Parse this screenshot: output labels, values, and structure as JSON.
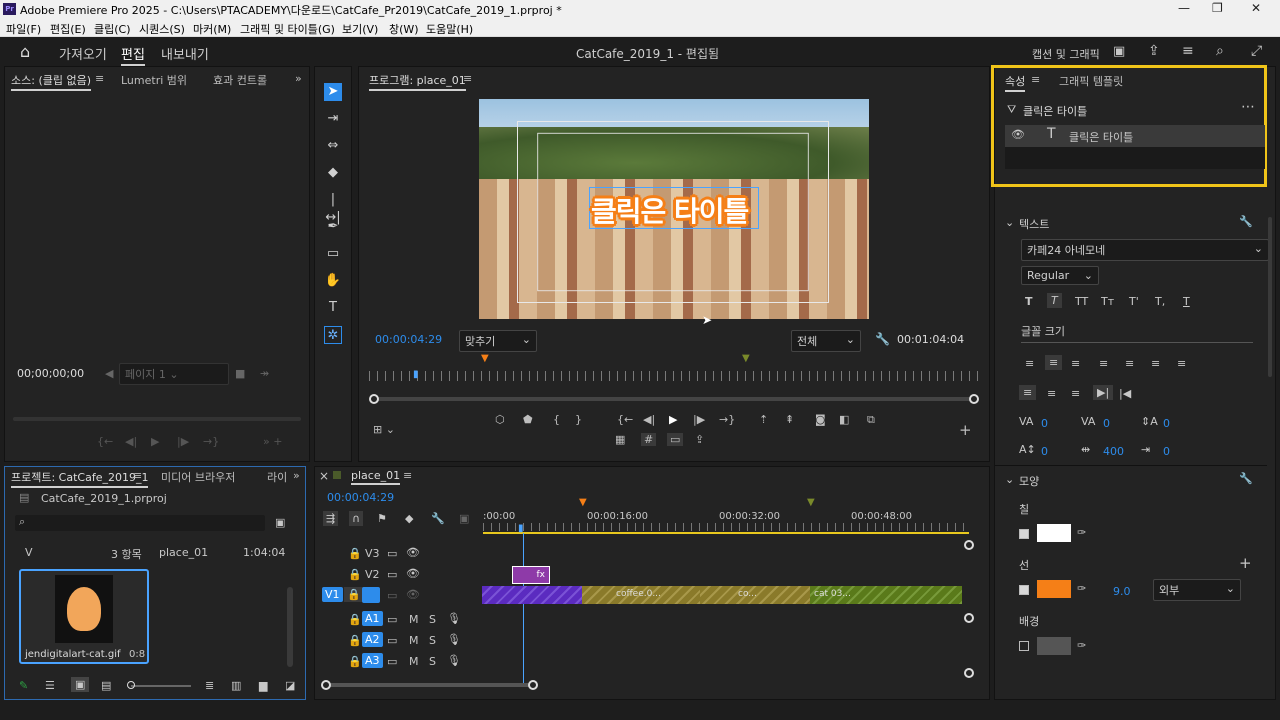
{
  "window": {
    "title": "Adobe Premiere Pro 2025 - C:\\Users\\PTACADEMY\\다운로드\\CatCafe_Pr2019\\CatCafe_2019_1.prproj *",
    "logo": "Pr"
  },
  "menu": [
    "파일(F)",
    "편집(E)",
    "클립(C)",
    "시퀀스(S)",
    "마커(M)",
    "그래픽 및 타이틀(G)",
    "보기(V)",
    "창(W)",
    "도움말(H)"
  ],
  "header": {
    "tabs": [
      "가져오기",
      "편집",
      "내보내기"
    ],
    "active": "편집",
    "project_title": "CatCafe_2019_1 - 편집됨",
    "right_label": "캡션 및 그래픽"
  },
  "source_panel": {
    "tabs": [
      "소스: (클립 없음)",
      "Lumetri 범위",
      "효과 컨트롤"
    ],
    "timecode": "00;00;00;00",
    "page": "페이지 1"
  },
  "program_monitor": {
    "tab": "프로그램: place_01",
    "timecode": "00:00:04:29",
    "fit": "맞추기",
    "quality": "전체",
    "duration": "00:01:04:04",
    "title_text": "클릭은 타이틀"
  },
  "project_panel": {
    "tabs": [
      "프로젝트: CatCafe_2019_1",
      "미디어 브라우저",
      "라이"
    ],
    "file": "CatCafe_2019_1.prproj",
    "count": "3 항목",
    "item_name": "place_01",
    "item_duration": "1:04:04",
    "thumb_name": "jendigitalart-cat.gif",
    "thumb_duration": "0:8",
    "col_v": "V"
  },
  "timeline": {
    "tab": "place_01",
    "timecode": "00:00:04:29",
    "ruler": [
      ":00:00",
      "00:00:16:00",
      "00:00:32:00",
      "00:00:48:00"
    ],
    "tracks": [
      "V3",
      "V2",
      "V1",
      "A1",
      "A2",
      "A3"
    ],
    "ms": [
      "M",
      "S"
    ],
    "clips": {
      "fx": "fx",
      "c1": "coffee.0...",
      "c2": "co...",
      "c3": "cat 03..."
    }
  },
  "properties": {
    "tabs": [
      "속성",
      "그래픽 템플릿"
    ],
    "layer_title": "클릭은 타이틀",
    "layer_item": "클릭은 타이틀",
    "text_section": "텍스트",
    "font": "카페24 아네모네",
    "style": "Regular",
    "font_size_label": "글꼴 크기",
    "tracking_vals": [
      "0",
      "0",
      "0",
      "0",
      "400",
      "0"
    ],
    "appearance": "모양",
    "fill": "칠",
    "stroke": "선",
    "stroke_width": "9.0",
    "stroke_type": "외부",
    "background": "배경"
  },
  "colors": {
    "accent": "#2d8ceb",
    "highlight": "#f0c419",
    "stroke": "#f57f17",
    "fill": "#ffffff",
    "clip_purple": "#5b2bc0",
    "clip_olive": "#8a7a2a",
    "clip_green": "#5a7a1a"
  }
}
